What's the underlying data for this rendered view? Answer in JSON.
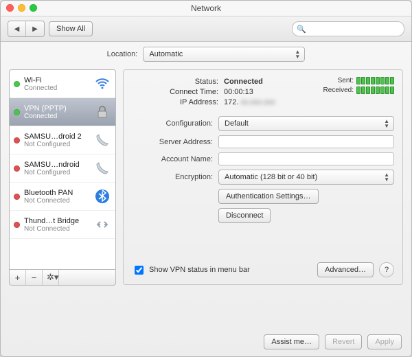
{
  "window": {
    "title": "Network"
  },
  "toolbar": {
    "show_all": "Show All",
    "search_placeholder": ""
  },
  "location": {
    "label": "Location:",
    "value": "Automatic"
  },
  "sidebar": {
    "items": [
      {
        "status": "green",
        "title": "Wi-Fi",
        "sub": "Connected",
        "icon": "wifi"
      },
      {
        "status": "green",
        "title": "VPN (PPTP)",
        "sub": "Connected",
        "icon": "lock",
        "selected": true
      },
      {
        "status": "red",
        "title": "SAMSU…droid 2",
        "sub": "Not Configured",
        "icon": "phone"
      },
      {
        "status": "red",
        "title": "SAMSU…ndroid",
        "sub": "Not Configured",
        "icon": "phone"
      },
      {
        "status": "red",
        "title": "Bluetooth PAN",
        "sub": "Not Connected",
        "icon": "bluetooth"
      },
      {
        "status": "red",
        "title": "Thund…t Bridge",
        "sub": "Not Connected",
        "icon": "bridge"
      }
    ]
  },
  "panel": {
    "status_label": "Status:",
    "status_value": "Connected",
    "connect_time_label": "Connect Time:",
    "connect_time_value": "00:00:13",
    "ip_label": "IP Address:",
    "ip_value": "172. ",
    "sent_label": "Sent:",
    "received_label": "Received:",
    "config_label": "Configuration:",
    "config_value": "Default",
    "server_label": "Server Address:",
    "server_value": " ",
    "account_label": "Account Name:",
    "account_value": " ",
    "encryption_label": "Encryption:",
    "encryption_value": "Automatic (128 bit or 40 bit)",
    "auth_settings": "Authentication Settings…",
    "disconnect": "Disconnect",
    "show_vpn": "Show VPN status in menu bar",
    "advanced": "Advanced…"
  },
  "footer": {
    "assist": "Assist me…",
    "revert": "Revert",
    "apply": "Apply"
  }
}
